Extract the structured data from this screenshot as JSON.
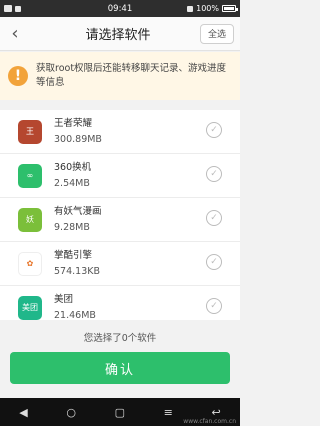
{
  "status_bar": {
    "time": "09:41",
    "battery": "100%",
    "battery_level": 1.0
  },
  "header": {
    "back_icon": "‹",
    "title": "请选择软件",
    "select_all_label": "全选"
  },
  "warning": {
    "icon": "!",
    "text": "获取root权限后还能转移聊天记录、游戏进度等信息"
  },
  "apps": [
    {
      "name": "王者荣耀",
      "size": "300.89MB",
      "icon_label": "王",
      "icon_color": "#b5472f",
      "selected": false
    },
    {
      "name": "360换机",
      "size": "2.54MB",
      "icon_label": "∞",
      "icon_color": "#2dbf6c",
      "selected": false
    },
    {
      "name": "有妖气漫画",
      "size": "9.28MB",
      "icon_label": "妖",
      "icon_color": "#7bbf3a",
      "selected": false
    },
    {
      "name": "掌酷引擎",
      "size": "574.13KB",
      "icon_label": "✿",
      "icon_color": "#ffffff",
      "selected": false
    },
    {
      "name": "美团",
      "size": "21.46MB",
      "icon_label": "美团",
      "icon_color": "#20b78a",
      "selected": false
    }
  ],
  "selection_summary": "您选择了0个软件",
  "confirm_label": "确认",
  "nav": {
    "back": "◀",
    "home": "○",
    "recent": "▢",
    "menu": "≡",
    "return": "↩"
  },
  "watermark": "www.cfan.com.cn"
}
